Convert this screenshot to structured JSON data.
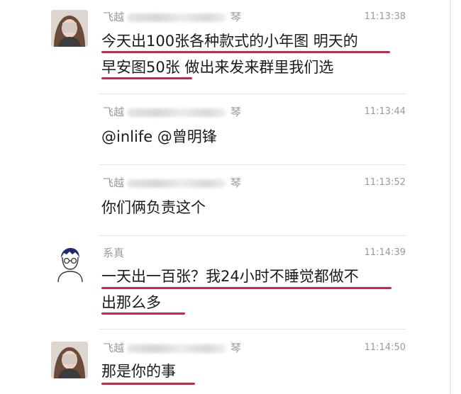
{
  "messages": [
    {
      "sender_prefix": "飞越",
      "sender_suffix": "琴",
      "time": "11:13:38",
      "lines": [
        "今天出100张各种款式的小年图 明天的",
        "早安图50张 做出来发来群里我们选"
      ]
    },
    {
      "sender_prefix": "飞越",
      "sender_suffix": "琴",
      "time": "11:13:44",
      "lines": [
        "@inlife @曾明锋"
      ]
    },
    {
      "sender_prefix": "飞越",
      "sender_suffix": "琴",
      "time": "11:13:52",
      "lines": [
        "你们俩负责这个"
      ]
    },
    {
      "sender_prefix": "系真",
      "sender_suffix": "",
      "time": "11:14:39",
      "lines": [
        "一天出一百张？我24小时不睡觉都做不",
        "出那么多"
      ]
    },
    {
      "sender_prefix": "飞越",
      "sender_suffix": "琴",
      "time": "11:14:50",
      "lines": [
        "那是你的事"
      ]
    }
  ],
  "colors": {
    "underline": "#c8284a",
    "meta_text": "#9a9a9a",
    "message_text": "#1a1a1a",
    "divider": "#e4e4e4"
  }
}
